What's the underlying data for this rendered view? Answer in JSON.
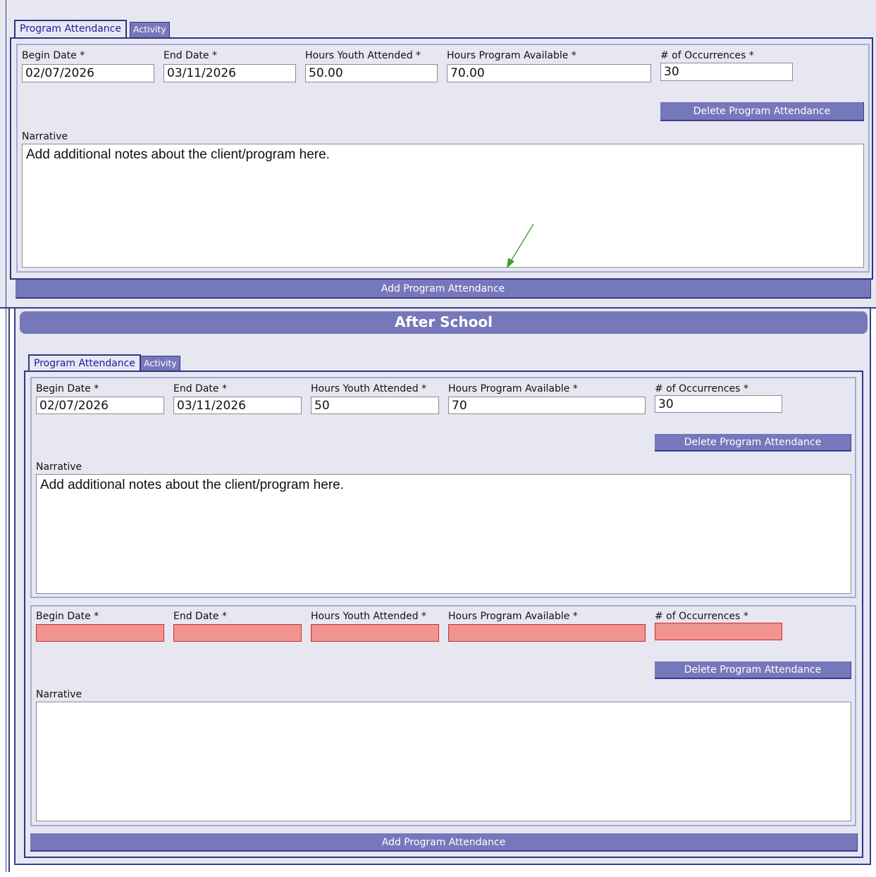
{
  "top_section": {
    "tabs": {
      "active": "Program Attendance",
      "inactive": "Activity"
    },
    "record": {
      "begin_date_label": "Begin Date *",
      "end_date_label": "End Date *",
      "hours_youth_label": "Hours Youth Attended *",
      "hours_program_label": "Hours Program Available *",
      "occurrences_label": "# of Occurrences *",
      "begin_date": "02/07/2026",
      "end_date": "03/11/2026",
      "hours_youth": "50.00",
      "hours_program": "70.00",
      "occurrences": "30",
      "delete_label": "Delete Program Attendance",
      "narrative_label": "Narrative",
      "narrative": "Add additional notes about the client/program here."
    },
    "add_label": "Add Program Attendance"
  },
  "after_school": {
    "title": "After School",
    "tabs": {
      "active": "Program Attendance",
      "inactive": "Activity"
    },
    "record1": {
      "begin_date_label": "Begin Date *",
      "end_date_label": "End Date *",
      "hours_youth_label": "Hours Youth Attended *",
      "hours_program_label": "Hours Program Available *",
      "occurrences_label": "# of Occurrences *",
      "begin_date": "02/07/2026",
      "end_date": "03/11/2026",
      "hours_youth": "50",
      "hours_program": "70",
      "occurrences": "30",
      "delete_label": "Delete Program Attendance",
      "narrative_label": "Narrative",
      "narrative": "Add additional notes about the client/program here."
    },
    "record2": {
      "begin_date_label": "Begin Date *",
      "end_date_label": "End Date *",
      "hours_youth_label": "Hours Youth Attended *",
      "hours_program_label": "Hours Program Available *",
      "occurrences_label": "# of Occurrences *",
      "begin_date": "",
      "end_date": "",
      "hours_youth": "",
      "hours_program": "",
      "occurrences": "",
      "delete_label": "Delete Program Attendance",
      "narrative_label": "Narrative",
      "narrative": ""
    },
    "add_label": "Add Program Attendance"
  },
  "annotation": {
    "arrow_color": "#3e9b2e"
  },
  "colors": {
    "accent": "#7777bb",
    "border": "#333380",
    "panel": "#e7e7f1",
    "error_fill": "#f0948f",
    "error_border": "#cf2b2b"
  }
}
